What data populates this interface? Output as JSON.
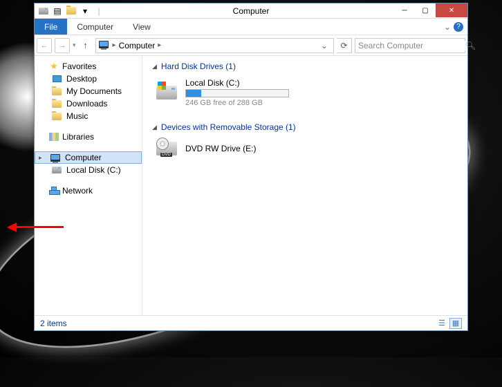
{
  "window": {
    "title": "Computer"
  },
  "ribbon": {
    "file": "File",
    "computer": "Computer",
    "view": "View"
  },
  "breadcrumb": {
    "text": "Computer"
  },
  "search": {
    "placeholder": "Search Computer"
  },
  "sidebar": {
    "favorites": {
      "label": "Favorites",
      "items": [
        "Desktop",
        "My Documents",
        "Downloads",
        "Music"
      ]
    },
    "libraries": {
      "label": "Libraries"
    },
    "computer": {
      "label": "Computer",
      "drives": [
        "Local Disk (C:)"
      ]
    },
    "network": {
      "label": "Network"
    }
  },
  "sections": {
    "hdd": {
      "label": "Hard Disk Drives (1)",
      "items": [
        {
          "name": "Local Disk (C:)",
          "free": "246 GB free of 288 GB",
          "used_pct": 15
        }
      ]
    },
    "removable": {
      "label": "Devices with Removable Storage (1)",
      "items": [
        {
          "name": "DVD RW Drive (E:)"
        }
      ]
    }
  },
  "status": {
    "count": "2 items"
  }
}
